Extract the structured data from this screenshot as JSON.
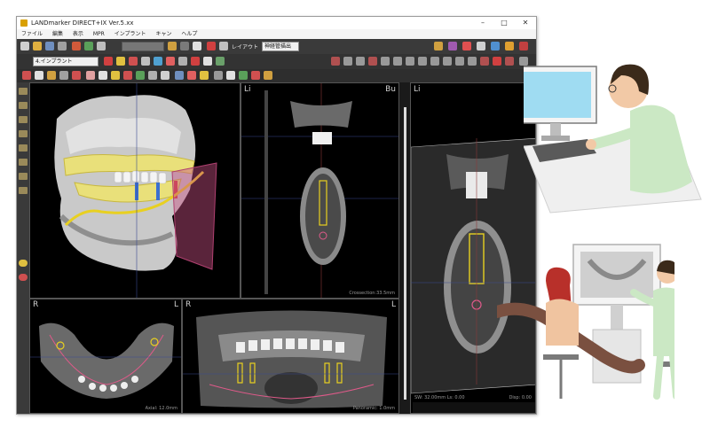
{
  "window": {
    "title": "LANDmarker DIRECT+IX Ver.5.xx",
    "menu": [
      "ファイル",
      "編集",
      "表示",
      "MPR",
      "インプラント",
      "キャン",
      "ヘルプ"
    ]
  },
  "toolbar": {
    "patient_dropdown": "4.インプラント",
    "layout_label": "レイアウト",
    "slice_select": "神経管描出"
  },
  "viewports": {
    "top_middle": {
      "tl": "Li",
      "tr": "Bu",
      "bottom_info": "Crossection:33.5mm"
    },
    "top_right": {
      "tl": "Li",
      "bottom_info": "SW: 32.00mm Ls: 0.00",
      "bottom_info_right": "Disp: 0.00"
    },
    "bottom_left": {
      "tl": "R",
      "tr": "L",
      "bottom_info": "Axial: 12.0mm"
    },
    "bottom_middle": {
      "tl": "R",
      "tr": "L",
      "bottom_info": "Panoramic: 1.0mm"
    }
  },
  "colors": {
    "implant": "#e8d020",
    "nerve": "#e05a8a",
    "toolbar": "#3a3a3a",
    "viewport_bg": "#000000",
    "staff_coat": "#cbe8c4"
  }
}
